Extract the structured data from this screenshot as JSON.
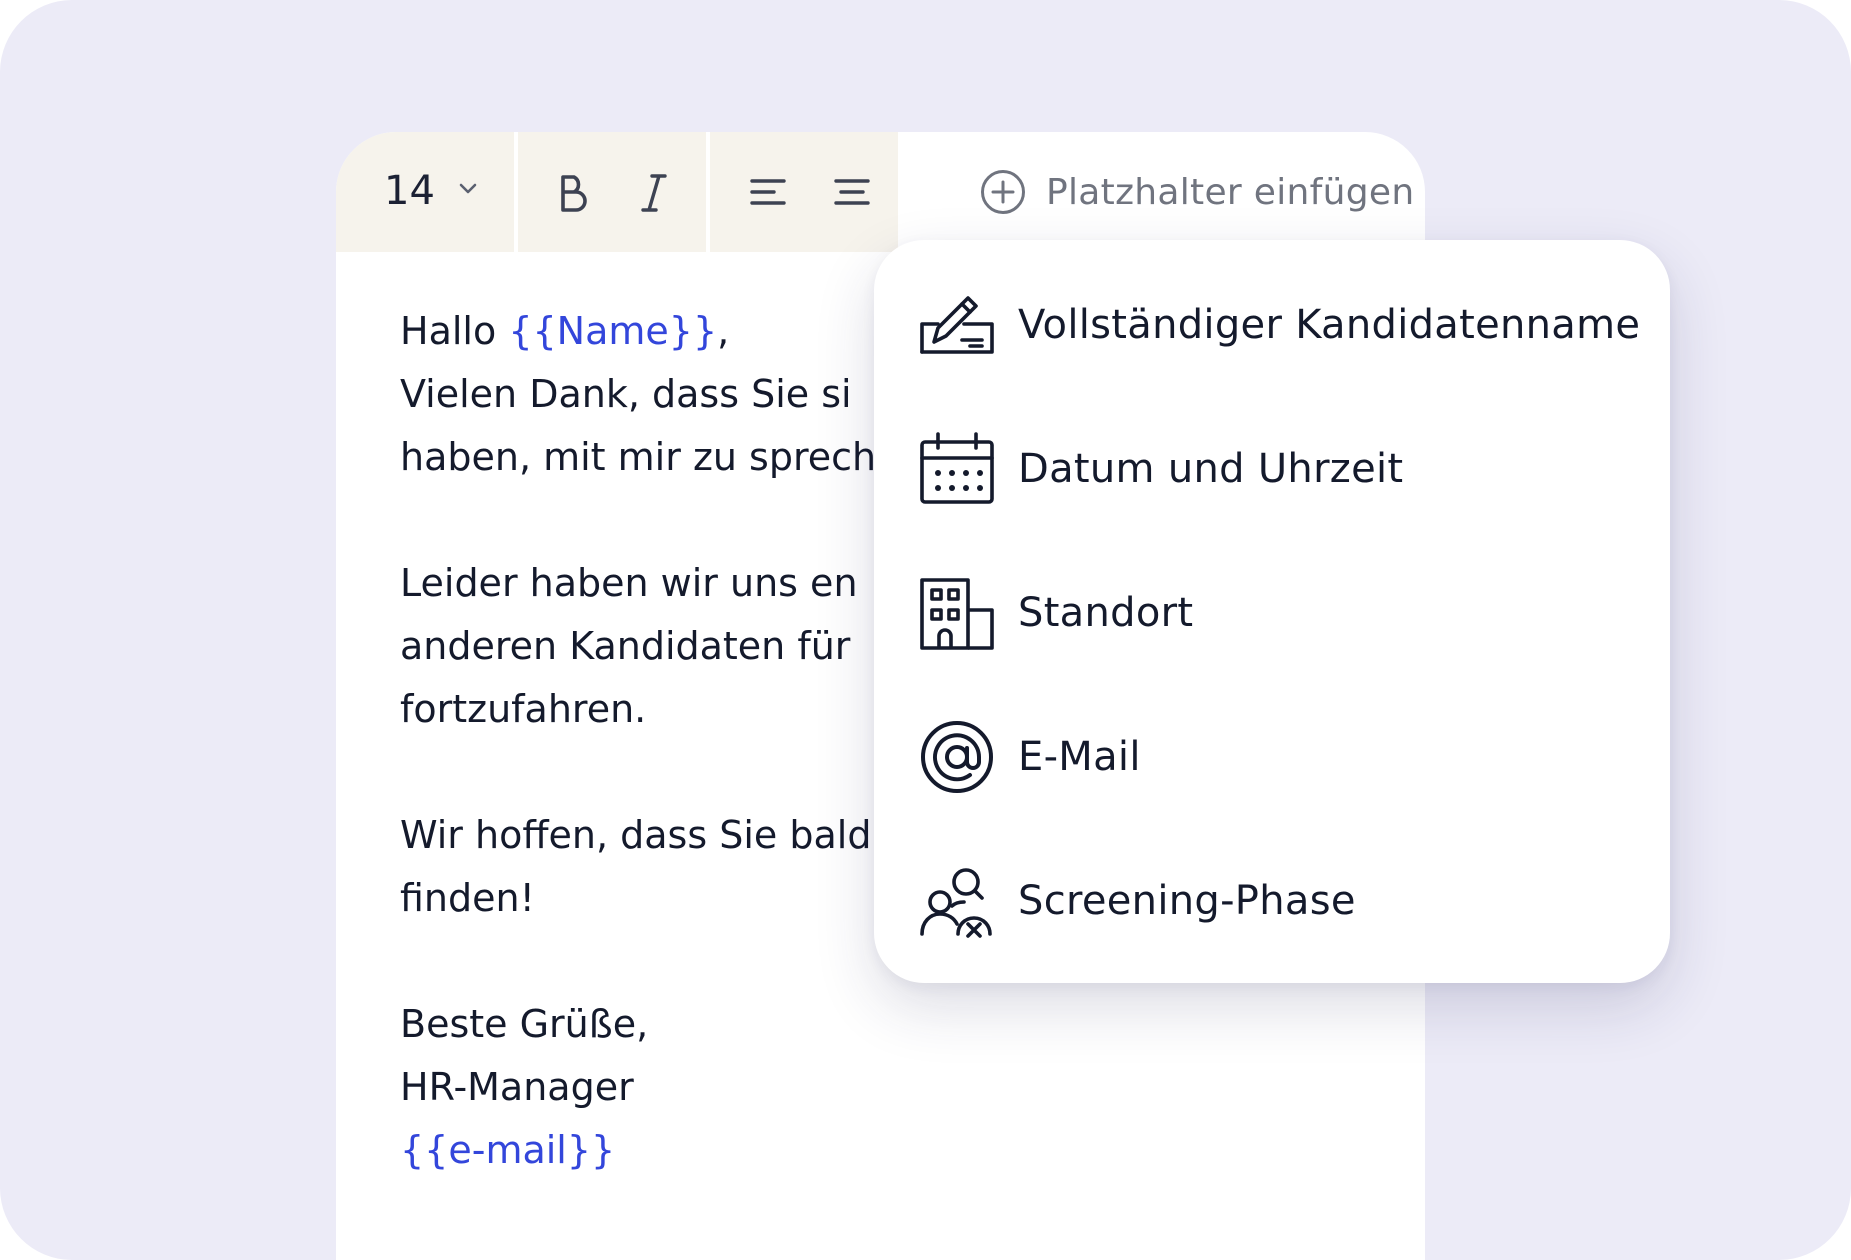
{
  "toolbar": {
    "font_size": "14",
    "placeholder_label": "Platzhalter einfügen"
  },
  "letter": {
    "greeting_prefix": "Hallo ",
    "name_token": "{{Name}}",
    "greeting_suffix": ",",
    "line2": "Vielen Dank, dass Sie si",
    "line3": "haben, mit mir zu sprech",
    "line5": "Leider haben wir uns en",
    "line6": "anderen Kandidaten für",
    "line7": "fortzufahren.",
    "line9": "Wir hoffen, dass Sie bald",
    "line10": "finden!",
    "closing": "Beste Grüße,",
    "signature_role": "HR-Manager",
    "email_token": "{{e-mail}}"
  },
  "dropdown": {
    "items": [
      {
        "label": "Vollständiger Kandidatenname",
        "icon": "signature-icon"
      },
      {
        "label": "Datum und Uhrzeit",
        "icon": "calendar-icon"
      },
      {
        "label": "Standort",
        "icon": "building-icon"
      },
      {
        "label": "E-Mail",
        "icon": "at-sign-icon"
      },
      {
        "label": "Screening-Phase",
        "icon": "users-search-icon"
      }
    ]
  },
  "colors": {
    "background": "#ecebf7",
    "toolbar": "#f6f3ec",
    "token": "#3346db",
    "text": "#141a2c"
  }
}
